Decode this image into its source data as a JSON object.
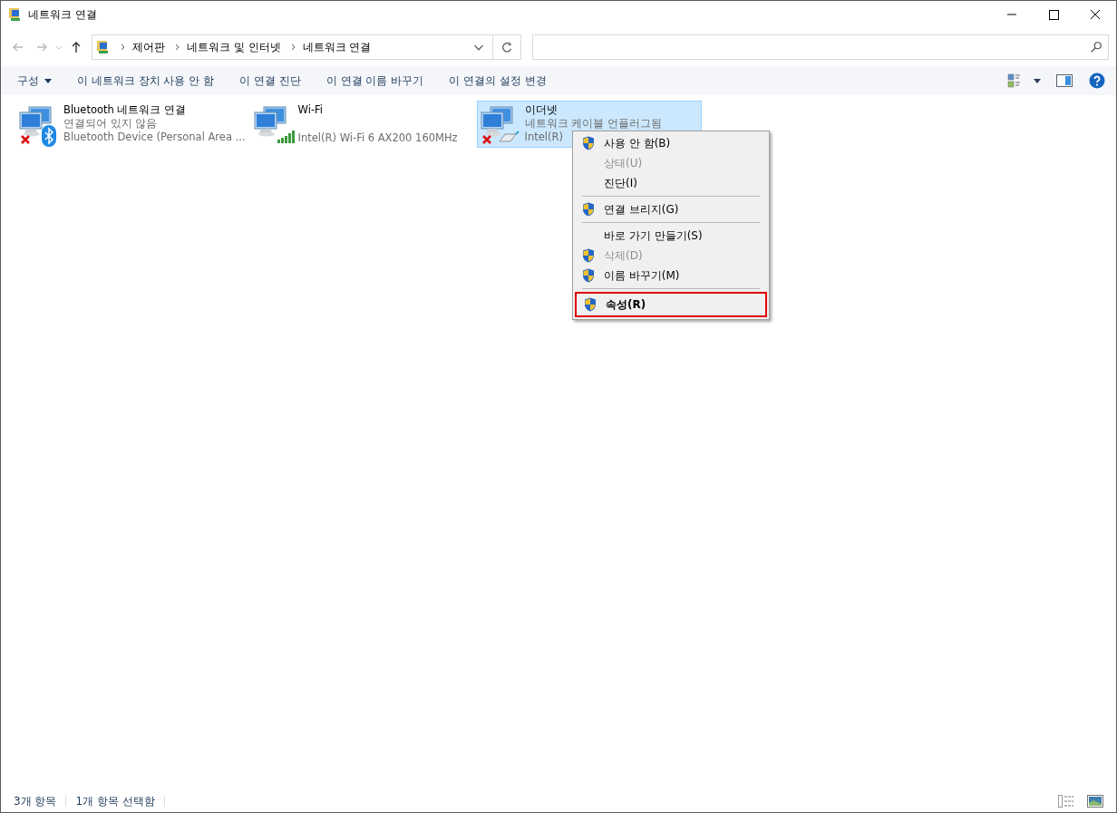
{
  "window": {
    "title": "네트워크 연결"
  },
  "address": {
    "crumbs": [
      "제어판",
      "네트워크 및 인터넷",
      "네트워크 연결"
    ]
  },
  "commands": [
    {
      "label": "구성",
      "kind": "dropdown"
    },
    {
      "label": "이 네트워크 장치 사용 안 함",
      "kind": "plain"
    },
    {
      "label": "이 연결 진단",
      "kind": "plain"
    },
    {
      "label": "이 연결 이름 바꾸기",
      "kind": "plain"
    },
    {
      "label": "이 연결의 설정 변경",
      "kind": "plain"
    }
  ],
  "connections": [
    {
      "name": "Bluetooth 네트워크 연결",
      "status": "연결되어 있지 않음",
      "device": "Bluetooth Device (Personal Area ...",
      "kind": "bluetooth",
      "disconnected": true,
      "selected": false
    },
    {
      "name": "Wi-Fi",
      "device": "Intel(R) Wi-Fi 6 AX200 160MHz",
      "kind": "wifi",
      "disconnected": false,
      "selected": false
    },
    {
      "name": "이더넷",
      "status": "네트워크 케이블 언플러그됨",
      "device": "Intel(R)",
      "kind": "ethernet",
      "disconnected": true,
      "selected": true
    }
  ],
  "context_menu": [
    {
      "kind": "item",
      "label": "사용 안 함(B)",
      "shield": true,
      "disabled": false,
      "highlighted": false
    },
    {
      "kind": "item",
      "label": "상태(U)",
      "shield": false,
      "disabled": true,
      "highlighted": false
    },
    {
      "kind": "item",
      "label": "진단(I)",
      "shield": false,
      "disabled": false,
      "highlighted": false
    },
    {
      "kind": "separator"
    },
    {
      "kind": "item",
      "label": "연결 브리지(G)",
      "shield": true,
      "disabled": false,
      "highlighted": false
    },
    {
      "kind": "separator"
    },
    {
      "kind": "item",
      "label": "바로 가기 만들기(S)",
      "shield": false,
      "disabled": false,
      "highlighted": false
    },
    {
      "kind": "item",
      "label": "삭제(D)",
      "shield": true,
      "disabled": true,
      "highlighted": false
    },
    {
      "kind": "item",
      "label": "이름 바꾸기(M)",
      "shield": true,
      "disabled": false,
      "highlighted": false
    },
    {
      "kind": "separator"
    },
    {
      "kind": "item",
      "label": "속성(R)",
      "shield": true,
      "disabled": false,
      "highlighted": true
    }
  ],
  "status_bar": {
    "count": "3개 항목",
    "selection": "1개 항목 선택함"
  }
}
